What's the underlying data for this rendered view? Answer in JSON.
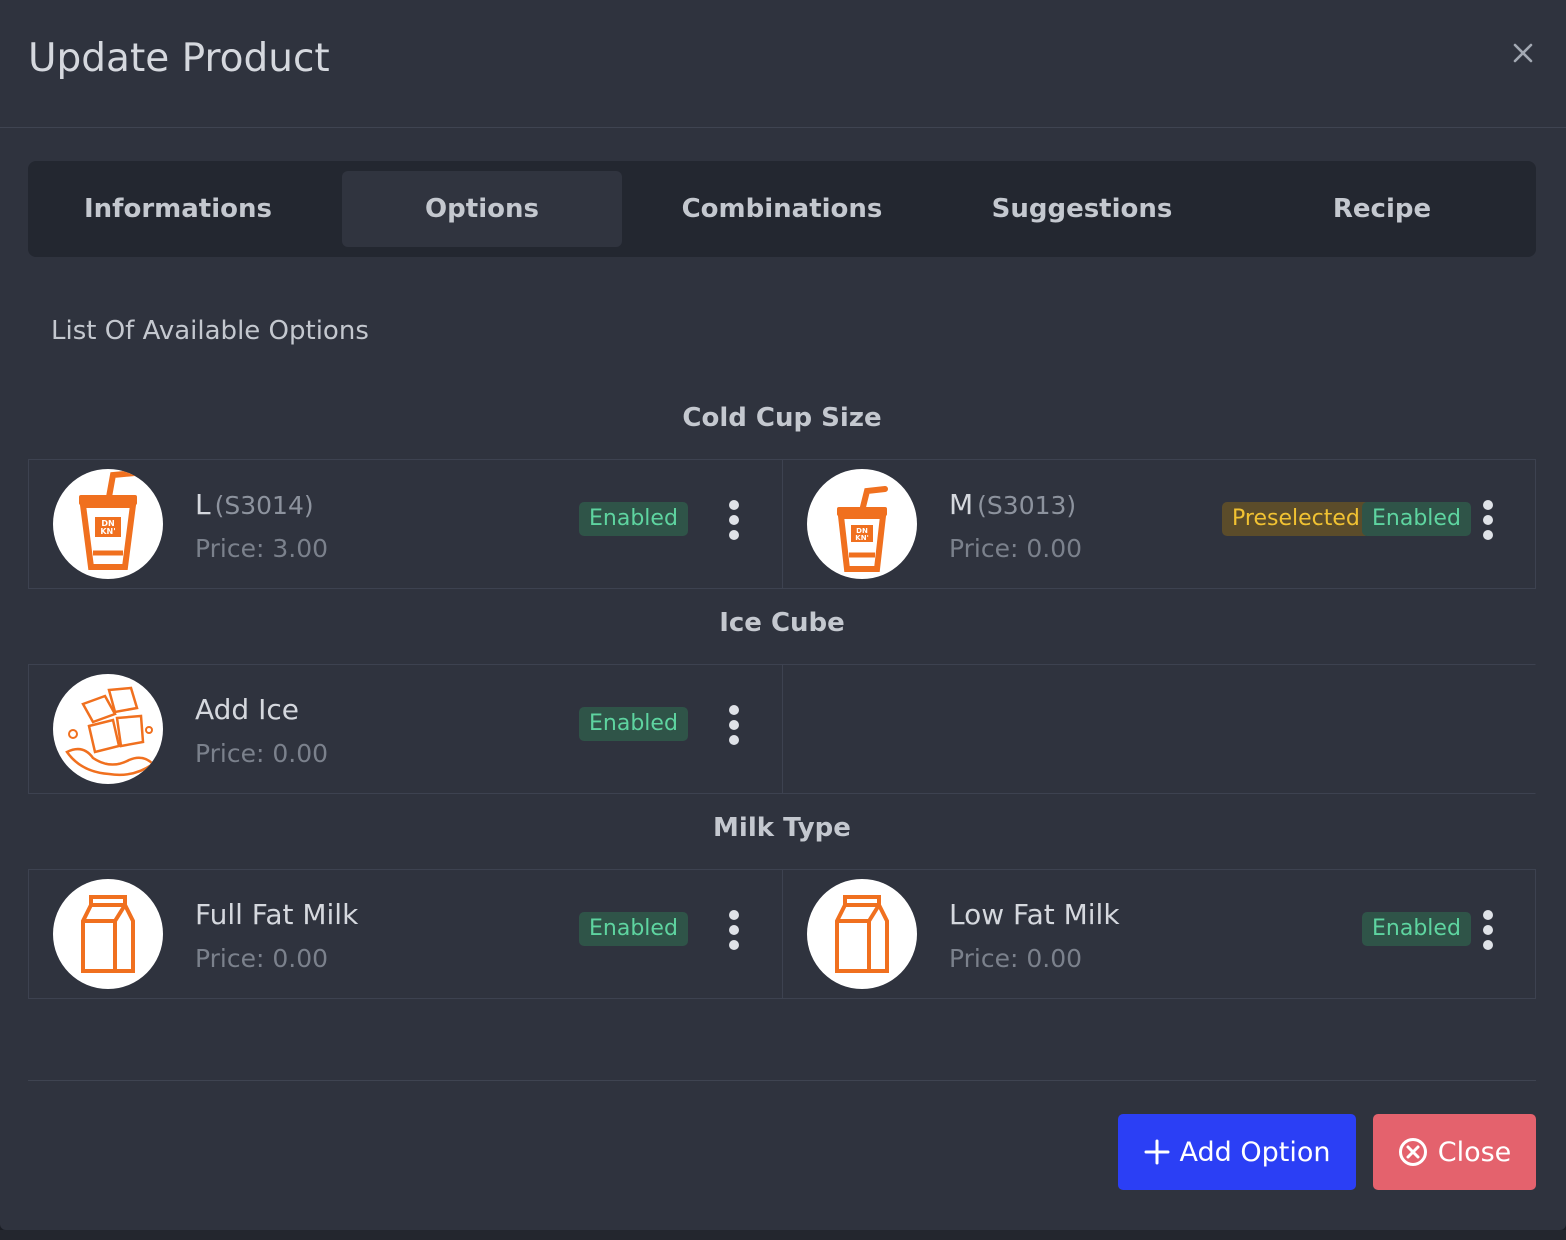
{
  "modal": {
    "title": "Update Product",
    "close_icon": "close-x-icon"
  },
  "tabs": [
    {
      "label": "Informations",
      "active": false
    },
    {
      "label": "Options",
      "active": true
    },
    {
      "label": "Combinations",
      "active": false
    },
    {
      "label": "Suggestions",
      "active": false
    },
    {
      "label": "Recipe",
      "active": false
    }
  ],
  "options_section": {
    "heading": "List Of Available Options",
    "groups": [
      {
        "title": "Cold Cup Size",
        "options": [
          {
            "name": "L",
            "code": "(S3014)",
            "price": "Price: 3.00",
            "badges": [
              "Enabled"
            ],
            "image": "dunkin-cold-cup-large-icon"
          },
          {
            "name": "M",
            "code": "(S3013)",
            "price": "Price: 0.00",
            "badges": [
              "Preselected",
              "Enabled"
            ],
            "image": "dunkin-cold-cup-medium-icon"
          }
        ]
      },
      {
        "title": "Ice Cube",
        "options": [
          {
            "name": "Add Ice",
            "code": "",
            "price": "Price: 0.00",
            "badges": [
              "Enabled"
            ],
            "image": "ice-cubes-icon"
          }
        ]
      },
      {
        "title": "Milk Type",
        "options": [
          {
            "name": "Full Fat Milk",
            "code": "",
            "price": "Price: 0.00",
            "badges": [
              "Enabled"
            ],
            "image": "milk-carton-icon"
          },
          {
            "name": "Low Fat Milk",
            "code": "",
            "price": "Price: 0.00",
            "badges": [
              "Enabled"
            ],
            "image": "milk-carton-icon"
          }
        ]
      }
    ]
  },
  "footer": {
    "add_label": "Add Option",
    "add_icon": "plus-icon",
    "close_label": "Close",
    "close_icon": "circle-x-icon"
  },
  "colors": {
    "modal_bg": "#2f333e",
    "tabs_bg": "#232730",
    "enabled_badge": "#5ed4a0",
    "preselected_badge": "#f1c232",
    "add_button": "#2b3ff5",
    "close_button": "#e4626d",
    "icon_accent": "#f0701f"
  }
}
